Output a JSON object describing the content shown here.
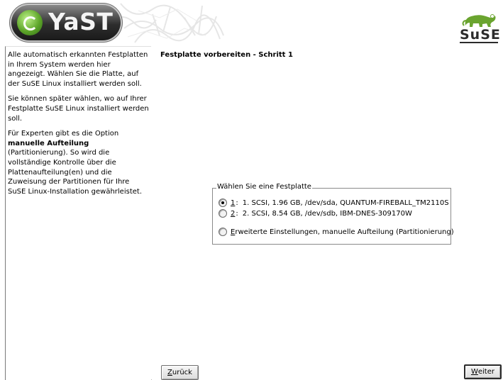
{
  "header": {
    "yast_logo_text": "YaST",
    "suse_logo_text": "SuSE",
    "banner_bg": "#ffffff",
    "yast_logo_color": "#2e2e2e",
    "suse_green": "#6aa42f"
  },
  "help": {
    "p1": "Alle automatisch erkannten Festplatten in Ihrem System werden hier angezeigt. Wählen Sie die Platte, auf der SuSE Linux installiert werden soll.",
    "p2": "Sie können später wählen, wo auf Ihrer Festplatte SuSE Linux installiert werden soll.",
    "p3_pre": "Für Experten gibt es die Option ",
    "p3_bold": "manuelle Aufteilung",
    "p3_post": " (Partitionierung). So wird die vollständige Kontrolle über die Plattenaufteilung(en) und die Zuweisung der Partitionen für Ihre SuSE Linux-Installation gewährleistet."
  },
  "main": {
    "title": "Festplatte vorbereiten - Schritt 1",
    "group_title": "Wählen Sie eine Festplatte",
    "options": [
      {
        "key": "1",
        "suffix": ":",
        "text": "1. SCSI, 1.96 GB, /dev/sda, QUANTUM-FIREBALL_TM2110S",
        "checked": true
      },
      {
        "key": "2",
        "suffix": ":",
        "text": "2. SCSI, 8.54 GB, /dev/sdb, IBM-DNES-309170W",
        "checked": false
      }
    ],
    "expert_key": "E",
    "expert_rest": "rweiterte Einstellungen, manuelle Aufteilung (Partitionierung)"
  },
  "buttons": {
    "back_key": "Z",
    "back_rest": "urück",
    "next_key": "W",
    "next_rest": "eiter"
  }
}
